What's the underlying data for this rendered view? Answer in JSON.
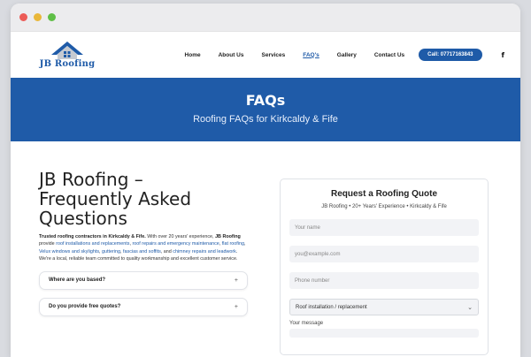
{
  "colors": {
    "brand": "#1f5ba8",
    "dot_red": "#ec5b56",
    "dot_yellow": "#e9b73a",
    "dot_green": "#5fbf47"
  },
  "logo": {
    "text": "JB Roofing",
    "icon": "house-roof-icon"
  },
  "nav": {
    "items": [
      "Home",
      "About Us",
      "Services",
      "FAQ's",
      "Gallery",
      "Contact Us"
    ],
    "active": "FAQ's",
    "call_button": "Call: 07717163843",
    "facebook_icon": "f"
  },
  "hero": {
    "title": "FAQs",
    "subtitle": "Roofing FAQs for Kirkcaldy & Fife"
  },
  "main": {
    "heading_line1": "JB Roofing –",
    "heading_line2": "Frequently Asked",
    "heading_line3": "Questions",
    "intro": {
      "bold1": "Trusted roofing contractors in Kirkcaldy & Fife.",
      "text1": " With over 20 years' experience, ",
      "bold2": "JB Roofing",
      "text2": " provide ",
      "link1": "roof installations and replacements",
      "text3": ", ",
      "link2": "roof repairs and emergency maintenance",
      "text4": ", ",
      "link3": "flat roofing",
      "text5": ", ",
      "link4": "Velux windows and skylights",
      "text6": ", ",
      "link5": "guttering",
      "text7": ", ",
      "link6": "fascias and soffits",
      "text8": ", and ",
      "link7": "chimney repairs and leadwork",
      "text9": ". We're a local, reliable team committed to quality workmanship and excellent customer service."
    },
    "faqs": [
      {
        "question": "Where are you based?",
        "toggle": "+"
      },
      {
        "question": "Do you provide free quotes?",
        "toggle": "+"
      }
    ]
  },
  "quote_form": {
    "title": "Request a Roofing Quote",
    "subtitle": "JB Roofing • 20+ Years' Experience • Kirkcaldy & Fife",
    "name_placeholder": "Your name",
    "email_placeholder": "you@example.com",
    "phone_placeholder": "Phone number",
    "service_selected": "Roof installation / replacement",
    "message_label": "Your message"
  }
}
